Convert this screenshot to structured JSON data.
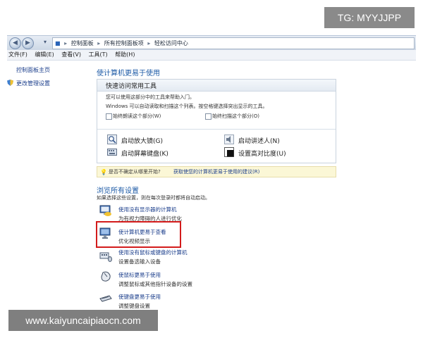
{
  "watermark_top": "TG: MYYJJPP",
  "watermark_bottom": "www.kaiyuncaipiaocn.com",
  "address": {
    "crumbs": [
      "控制面板",
      "所有控制面板项",
      "轻松访问中心"
    ],
    "separator": "▸"
  },
  "menu": [
    "文件(F)",
    "编辑(E)",
    "查看(V)",
    "工具(T)",
    "帮助(H)"
  ],
  "left_panel": {
    "home_link": "控制面板主页",
    "admin_link": "更改管理设置"
  },
  "main": {
    "title": "使计算机更易于使用",
    "quick": {
      "header": "快速访问常用工具",
      "line1": "您可以使用这部分中的工具来帮助入门。",
      "line2": "Windows 可以自动读取和扫描这个列表。按空格键选择突出显示的工具。",
      "check_read": "始终朗读这个部分(W)",
      "check_scan": "始终扫描这个部分(O)",
      "tools": {
        "magnifier": "启动放大镜(G)",
        "narrator": "启动讲述人(N)",
        "osk": "启动屏幕键盘(K)",
        "contrast": "设置高对比度(U)"
      }
    },
    "hint": {
      "question": "是否不确定从哪里开始?",
      "link": "获取使您的计算机更易于使用的建议(R)"
    },
    "browse_title": "浏览所有设置",
    "browse_desc": "如果选择这些设置，则在每次登录时都将自动启动。",
    "categories": [
      {
        "title": "使用没有显示器的计算机",
        "sub": "为有视力障碍的人进行优化"
      },
      {
        "title": "使计算机更易于查看",
        "sub": "优化视频显示"
      },
      {
        "title": "使用没有鼠标或键盘的计算机",
        "sub": "设置备选输入设备"
      },
      {
        "title": "使鼠标更易于使用",
        "sub": "调整鼠标或其他指针设备的设置"
      },
      {
        "title": "使键盘更易于使用",
        "sub": "调整键盘设置"
      }
    ]
  }
}
